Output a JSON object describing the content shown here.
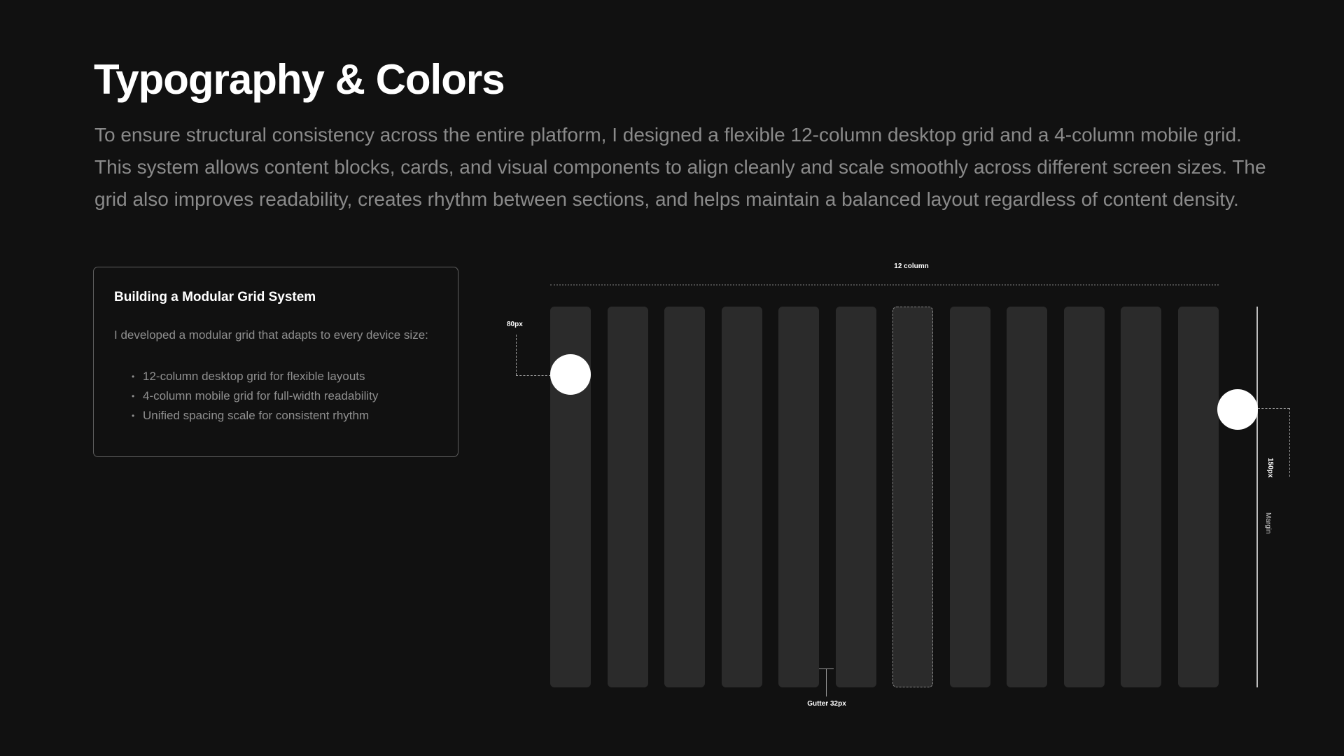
{
  "header": {
    "title": "Typography & Colors",
    "intro": "To ensure structural consistency across the entire platform, I designed a flexible 12-column desktop grid and a 4-column mobile grid. This system allows content blocks, cards, and visual components to align cleanly and scale smoothly across different screen sizes. The grid also improves readability, creates rhythm between sections, and helps maintain a balanced layout regardless of content density."
  },
  "card": {
    "title": "Building a Modular Grid System",
    "description": "I developed a modular grid that adapts to every device size:",
    "items": [
      "12-column desktop grid for flexible layouts",
      "4-column mobile grid for full-width readability",
      "Unified spacing scale for consistent rhythm"
    ],
    "bullet": "•"
  },
  "grid_diagram": {
    "column_label": "12 column",
    "offset_label": "80px",
    "gutter_label": "Gutter 32px",
    "height_label": "150px",
    "margin_label": "Margin",
    "column_count": 12,
    "highlighted_column": 7
  },
  "colors": {
    "background": "#111111",
    "column": "#2b2b2b",
    "title": "#ffffff",
    "body_text": "#8a8a8a",
    "card_border": "#5e5e5e"
  }
}
